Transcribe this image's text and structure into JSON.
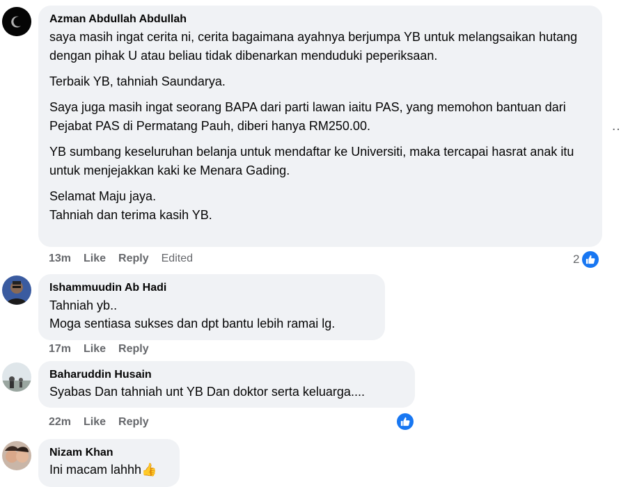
{
  "comments": [
    {
      "author": "Azman Abdullah Abdullah",
      "paragraphs": [
        "saya masih ingat cerita ni, cerita bagaimana ayahnya berjumpa YB untuk melangsaikan hutang dengan pihak U atau beliau tidak dibenarkan menduduki peperiksaan.",
        "Terbaik YB, tahniah Saundarya.",
        "Saya juga masih ingat seorang BAPA dari parti lawan iaitu PAS, yang memohon bantuan dari Pejabat PAS di Permatang Pauh, diberi hanya RM250.00.",
        "YB sumbang keseluruhan belanja untuk mendaftar ke Universiti, maka tercapai hasrat anak itu untuk menjejakkan kaki ke Menara Gading.",
        "Selamat Maju jaya.\nTahniah dan terima kasih YB."
      ],
      "time": "13m",
      "like": "Like",
      "reply": "Reply",
      "edited": "Edited",
      "reaction_count": "2"
    },
    {
      "author": "Ishammuudin Ab Hadi",
      "paragraphs": [
        "Tahniah yb..\nMoga sentiasa sukses dan dpt bantu lebih ramai lg."
      ],
      "time": "17m",
      "like": "Like",
      "reply": "Reply"
    },
    {
      "author": "Baharuddin Husain",
      "paragraphs": [
        "Syabas Dan tahniah unt YB Dan doktor serta keluarga...."
      ],
      "time": "22m",
      "like": "Like",
      "reply": "Reply"
    },
    {
      "author": "Nizam Khan",
      "paragraphs": [
        "Ini macam lahhh👍"
      ]
    }
  ],
  "more_options": "…",
  "colors": {
    "bubble": "#f0f2f5",
    "meta": "#65676b",
    "like_blue": "#1877f2"
  }
}
